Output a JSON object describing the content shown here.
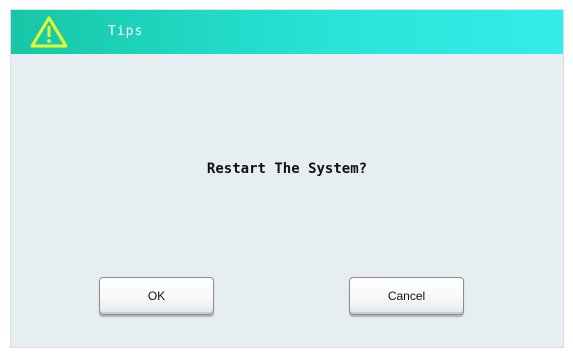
{
  "dialog": {
    "title": "Tips",
    "icon": "warning-triangle-icon",
    "message": "Restart The System?",
    "ok_label": "OK",
    "cancel_label": "Cancel"
  },
  "colors": {
    "titlebar_start": "#18c6a6",
    "titlebar_end": "#34ecea",
    "icon": "#e6ff2a",
    "background": "#e6eef2"
  }
}
